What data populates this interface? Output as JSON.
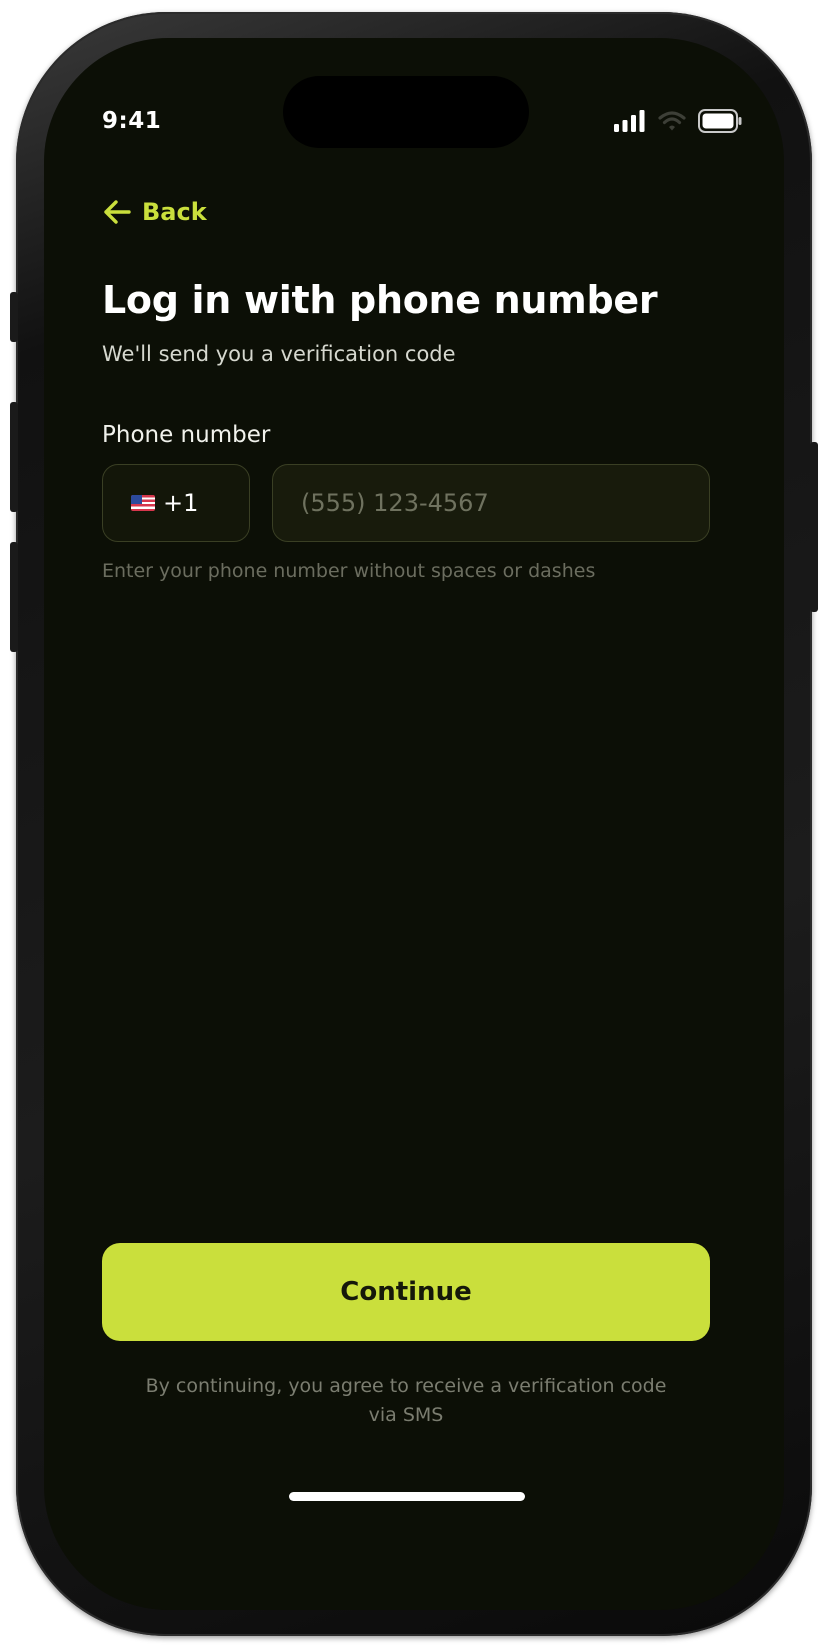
{
  "status_bar": {
    "time": "9:41",
    "icons": [
      "cellular-signal-icon",
      "wifi-icon",
      "battery-icon"
    ]
  },
  "nav": {
    "back_label": "Back",
    "back_icon": "arrow-left-icon"
  },
  "header": {
    "title": "Log in with phone number",
    "subtitle": "We'll send you a verification code"
  },
  "form": {
    "label": "Phone number",
    "country_code": "+1",
    "country_flag": "us-flag-icon",
    "phone_value": "",
    "phone_placeholder": "(555) 123-4567",
    "hint": "Enter your phone number without spaces or dashes"
  },
  "actions": {
    "continue_label": "Continue"
  },
  "legal": {
    "line1": "By continuing, you agree to receive a verification code",
    "line2": "via SMS"
  },
  "colors": {
    "accent": "#cadf3c",
    "background": "#0c0f06",
    "input_border": "#3a3f24",
    "hint_text": "#6b6d5f"
  }
}
